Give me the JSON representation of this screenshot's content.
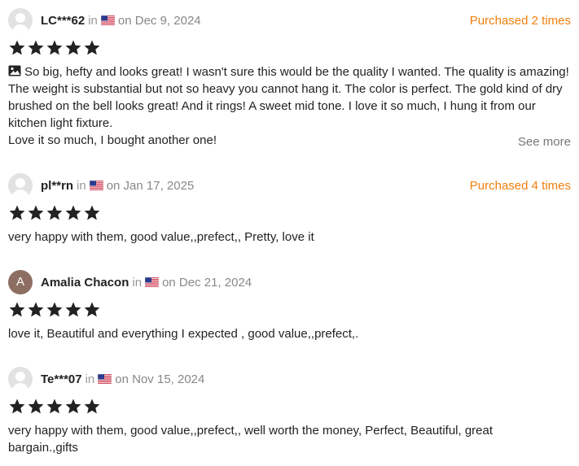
{
  "common": {
    "in_label": "in",
    "flag_icon": "us-flag-icon",
    "star_icon": "star-icon",
    "star_color": "#222222",
    "purchased_color": "#f07f0d"
  },
  "reviews": [
    {
      "name": "LC***62",
      "date": "on Dec 9, 2024",
      "purchased": "Purchased 2 times",
      "rating": 5,
      "has_image_icon": true,
      "text": "So big, hefty and looks great! I wasn't sure this would be the quality I wanted. The quality is amazing! The weight is substantial but not so heavy you cannot hang it. The color is perfect. The gold kind of dry brushed on the bell looks great! And it rings! A sweet mid tone. I love it so much, I hung it from our kitchen light fixture.",
      "text2": "Love it so much, I bought another one!",
      "see_more": "See more"
    },
    {
      "name": "pl**rn",
      "date": "on Jan 17, 2025",
      "purchased": "Purchased 4 times",
      "rating": 5,
      "text": "very happy with them, good value,,prefect,, Pretty, love it"
    },
    {
      "name": "Amalia Chacon",
      "avatar_letter": "A",
      "date": "on Dec 21, 2024",
      "rating": 5,
      "text": "love it, Beautiful and everything I expected , good value,,prefect,."
    },
    {
      "name": "Te***07",
      "date": "on Nov 15, 2024",
      "rating": 5,
      "text": "very happy with them, good value,,prefect,, well worth the money, Perfect, Beautiful, great bargain.,gifts"
    }
  ]
}
